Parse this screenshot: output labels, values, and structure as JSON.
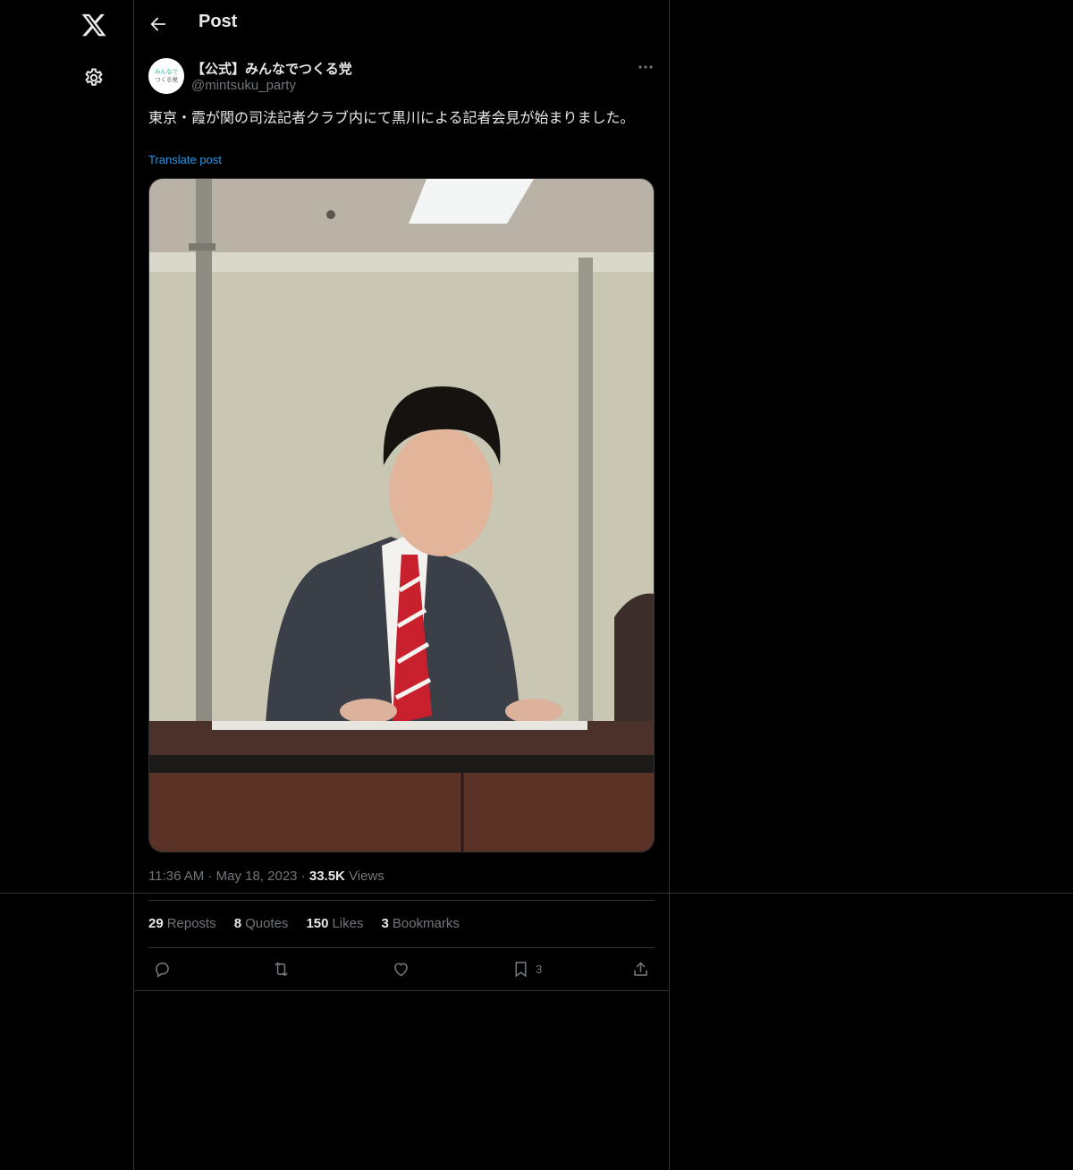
{
  "header": {
    "title": "Post"
  },
  "post": {
    "display_name": "【公式】みんなでつくる党",
    "handle": "@mintsuku_party",
    "avatar_text": [
      "みんなで",
      "つくる党"
    ],
    "text": "東京・霞が関の司法記者クラブ内にて黒川による記者会見が始まりました。",
    "translate_label": "Translate post",
    "time": "11:36 AM",
    "date": "May 18, 2023",
    "views_count": "33.5K",
    "views_label": "Views"
  },
  "stats": {
    "reposts": {
      "count": "29",
      "label": "Reposts"
    },
    "quotes": {
      "count": "8",
      "label": "Quotes"
    },
    "likes": {
      "count": "150",
      "label": "Likes"
    },
    "bookmarks": {
      "count": "3",
      "label": "Bookmarks"
    }
  },
  "actions": {
    "bookmark_count": "3"
  },
  "icons": [
    "x-logo-icon",
    "gear-icon",
    "back-arrow-icon",
    "more-icon",
    "reply-icon",
    "repost-icon",
    "like-icon",
    "bookmark-icon",
    "share-icon"
  ],
  "colors": {
    "background": "#000000",
    "text": "#e7e9ea",
    "muted": "#71767b",
    "link": "#1d9bf0",
    "border": "#2f3336"
  }
}
